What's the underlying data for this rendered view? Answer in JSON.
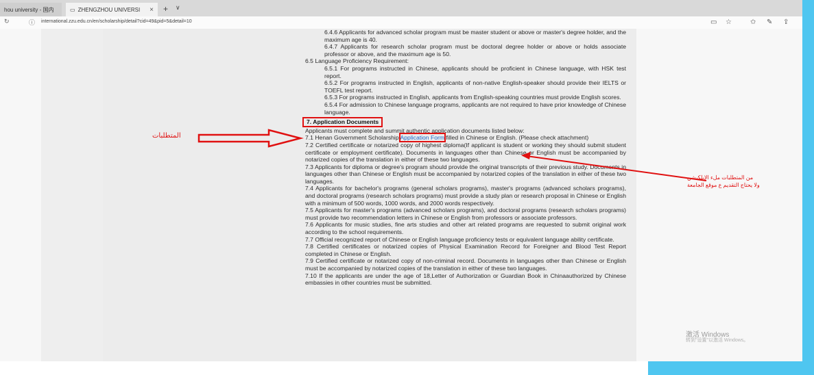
{
  "browser": {
    "tabs": [
      {
        "label": "hou university - 国内"
      },
      {
        "label": "ZHENGZHOU UNIVERSI"
      }
    ],
    "close_symbol": "×",
    "new_tab_symbol": "+",
    "tab_list_symbol": "∨",
    "url": "international.zzu.edu.cn/en/scholarship/detail?cid=49&pid=5&detail=10"
  },
  "document": {
    "lines": [
      {
        "indent": 1,
        "text": "6.4.6 Applicants for advanced scholar program must be master student or above or master's degree holder, and the maximum age is 40."
      },
      {
        "indent": 1,
        "text": "6.4.7 Applicants for research scholar program must be doctoral degree holder or above or holds associate professor or above, and the maximum age is 50."
      },
      {
        "indent": 0,
        "text": "6.5 Language Proficiency Requirement:"
      },
      {
        "indent": 1,
        "text": "6.5.1 For programs instructed in Chinese, applicants should be proficient in Chinese language, with HSK test report."
      },
      {
        "indent": 1,
        "text": "6.5.2 For programs instructed in English, applicants of non-native English-speaker should provide their IELTS or TOEFL test report."
      },
      {
        "indent": 1,
        "text": "6.5.3 For programs instructed in English, applicants from English-speaking countries must provide English scores."
      },
      {
        "indent": 1,
        "text": "6.5.4 For admission to Chinese language programs, applicants are not required to have prior knowledge of Chinese language."
      }
    ],
    "section_title": "7. Application Documents",
    "intro": "Applicants must complete and summit authentic application documents listed below:",
    "item_71_before": "7.1 Henan Government Scholarship ",
    "item_71_link": "Application Form",
    "item_71_after": " filled in Chinese or English. (Please check attachment)",
    "items": [
      "7.2 Certified certificate or notarized copy of highest diploma(If applicant is student or working they should submit student certificate or employment certificate). Documents in languages other than Chinese or English must be accompanied by notarized copies of the translation in either of these two languages.",
      "7.3 Applicants for diploma or degree's program should provide the original transcripts of their previous study. Documents in languages other than Chinese or English must be accompanied by notarized copies of the translation in either of these two languages.",
      "7.4 Applicants for bachelor's programs (general scholars programs), master's programs (advanced scholars programs), and doctoral programs (research scholars programs) must provide a study plan or research proposal in Chinese or English with a minimum of 500 words, 1000 words, and 2000 words respectively.",
      "7.5 Applicants for master's programs (advanced scholars programs), and doctoral programs (research scholars programs) must provide two recommendation letters in Chinese or English from professors or associate professors.",
      "7.6 Applicants for music studies, fine arts studies and other art related programs are requested to submit original work according to the school requirements.",
      "7.7 Official recognized report of Chinese or English language proficiency tests or equivalent language ability certificate.",
      "7.8 Certified certificates or notarized copies of Physical Examination Record for Foreigner and Blood Test Report completed in Chinese or English.",
      "7.9 Certified certificate or notarized copy of non-criminal record. Documents in languages other than Chinese or English must be accompanied by notarized copies of the translation in either of these two languages.",
      "7.10 If the applicants are under the age of 18,Letter of Authorization or Guardian Book in Chinaauthorized by Chinese embassies in other countries must be submitted."
    ]
  },
  "annotations": {
    "requirements_label": "المتطلبات",
    "form_note_line1": "من المتطلبات ملء الإبلكيشن",
    "form_note_line2": "ولا يحتاج التقديم ع موقع الجامعة",
    "arrow_color": "#e01010"
  },
  "watermark": {
    "title": "激活 Windows",
    "subtitle": "转到\"设置\"以激活 Windows。"
  }
}
